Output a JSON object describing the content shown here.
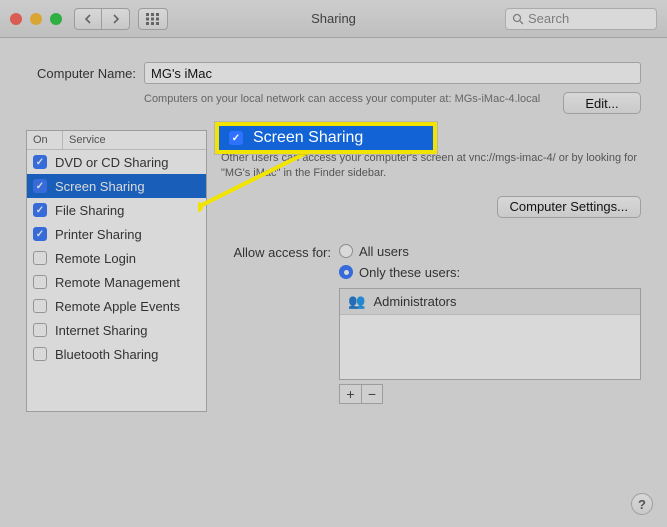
{
  "window": {
    "title": "Sharing",
    "search_placeholder": "Search"
  },
  "computer_name": {
    "label": "Computer Name:",
    "value": "MG's iMac",
    "description": "Computers on your local network can access your computer at: MGs-iMac-4.local",
    "edit_label": "Edit..."
  },
  "services": {
    "header_on": "On",
    "header_service": "Service",
    "rows": [
      {
        "on": true,
        "label": "DVD or CD Sharing",
        "selected": false
      },
      {
        "on": true,
        "label": "Screen Sharing",
        "selected": true
      },
      {
        "on": true,
        "label": "File Sharing",
        "selected": false
      },
      {
        "on": true,
        "label": "Printer Sharing",
        "selected": false
      },
      {
        "on": false,
        "label": "Remote Login",
        "selected": false
      },
      {
        "on": false,
        "label": "Remote Management",
        "selected": false
      },
      {
        "on": false,
        "label": "Remote Apple Events",
        "selected": false
      },
      {
        "on": false,
        "label": "Internet Sharing",
        "selected": false
      },
      {
        "on": false,
        "label": "Bluetooth Sharing",
        "selected": false
      }
    ]
  },
  "detail": {
    "status_title": "Screen Sharing: On",
    "status_color": "#2fbf3c",
    "info_text": "Other users can access your computer's screen at vnc://mgs-imac-4/ or by looking for \"MG's iMac\" in the Finder sidebar.",
    "computer_settings_label": "Computer Settings...",
    "access_label": "Allow access for:",
    "radio_all": "All users",
    "radio_only": "Only these users:",
    "radio_selected": "only",
    "users": [
      "Administrators"
    ],
    "plus": "+",
    "minus": "−"
  },
  "help_label": "?",
  "callout": {
    "label": "Screen Sharing"
  }
}
